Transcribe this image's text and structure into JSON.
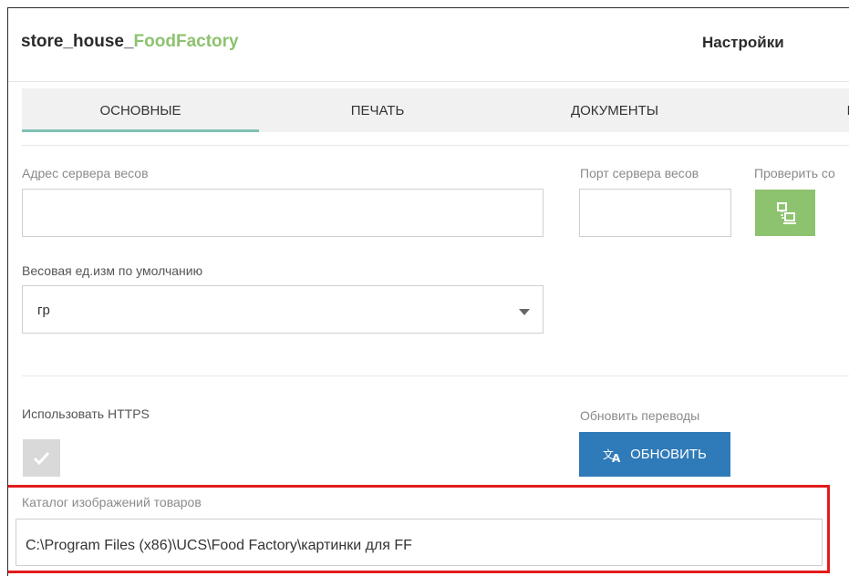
{
  "header": {
    "app_title_prefix": "store_house_",
    "app_title_accent": "FoodFactory",
    "page_title": "Настройки"
  },
  "tabs": [
    {
      "label": "ОСНОВНЫЕ",
      "active": true
    },
    {
      "label": "ПЕЧАТЬ",
      "active": false
    },
    {
      "label": "ДОКУМЕНТЫ",
      "active": false
    },
    {
      "label": "R",
      "active": false
    }
  ],
  "form": {
    "scale_server_address": {
      "label": "Адрес сервера весов",
      "value": ""
    },
    "scale_server_port": {
      "label": "Порт сервера весов",
      "value": ""
    },
    "check_connection": {
      "label": "Проверить со",
      "icon": "network-check-icon"
    },
    "default_weight_unit": {
      "label": "Весовая ед.изм по умолчанию",
      "value": "гр"
    },
    "use_https": {
      "label": "Использовать HTTPS",
      "checked": false
    },
    "update_translations": {
      "label": "Обновить переводы",
      "button_label": "ОБНОВИТЬ",
      "icon": "translate-icon"
    },
    "images_directory": {
      "label": "Каталог изображений товаров",
      "value": "C:\\Program Files (x86)\\UCS\\Food Factory\\картинки для FF"
    }
  },
  "colors": {
    "accent_green": "#8dc26f",
    "primary_blue": "#2f7ab8",
    "tab_underline": "#7fc1b4",
    "highlight_red": "#e31c1c"
  }
}
